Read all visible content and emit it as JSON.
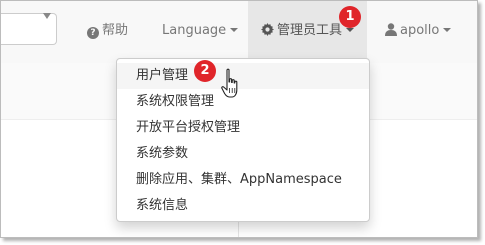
{
  "navbar": {
    "help_label": "帮助",
    "language_label": "Language",
    "admin_tools_label": "管理员工具",
    "user_label": "apollo"
  },
  "admin_menu": {
    "items": [
      {
        "label": "用户管理"
      },
      {
        "label": "系统权限管理"
      },
      {
        "label": "开放平台授权管理"
      },
      {
        "label": "系统参数"
      },
      {
        "label": "删除应用、集群、AppNamespace"
      },
      {
        "label": "系统信息"
      }
    ]
  },
  "annotations": {
    "step1": "1",
    "step2": "2"
  },
  "icons": {
    "help": "question-circle-icon",
    "admin": "gear-icon",
    "user": "user-icon",
    "pointer": "hand-pointer-icon"
  },
  "colors": {
    "badge": "#e0252a",
    "navbar_bg": "#f8f8f8",
    "active_bg": "#e7e7e7",
    "nav_text": "#777777"
  }
}
